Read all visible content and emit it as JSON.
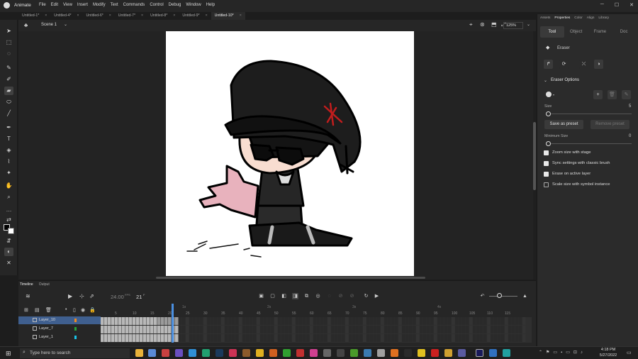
{
  "app": {
    "name": "Animate",
    "menus": [
      "File",
      "Edit",
      "View",
      "Insert",
      "Modify",
      "Text",
      "Commands",
      "Control",
      "Debug",
      "Window",
      "Help"
    ]
  },
  "doc_tabs": [
    {
      "label": "Untitled-1*",
      "active": false
    },
    {
      "label": "Untitled-4*",
      "active": false
    },
    {
      "label": "Untitled-6*",
      "active": false
    },
    {
      "label": "Untitled-7*",
      "active": false
    },
    {
      "label": "Untitled-8*",
      "active": false
    },
    {
      "label": "Untitled-9*",
      "active": false
    },
    {
      "label": "Untitled-10*",
      "active": true
    }
  ],
  "scene": {
    "label": "Scene 1",
    "zoom": "125%"
  },
  "properties_panel": {
    "tabs": [
      "Assets",
      "Properties",
      "Color",
      "Align",
      "Library"
    ],
    "active_tab": "Properties",
    "subtabs": [
      "Tool",
      "Object",
      "Frame",
      "Doc"
    ],
    "active_subtab": "Tool",
    "tool_name": "Eraser",
    "section": "Eraser Options",
    "size_label": "Size",
    "size_value": "5",
    "size_fraction": 0.0,
    "save_preset": "Save as preset",
    "remove_preset": "Remove preset",
    "min_size_label": "Minimum Size",
    "min_size_value": "0",
    "options": [
      {
        "label": "Zoom size with stage",
        "checked": true
      },
      {
        "label": "Sync settings with classic brush",
        "checked": true
      },
      {
        "label": "Erase on active layer",
        "checked": true
      },
      {
        "label": "Scale size with symbol instance",
        "checked": false
      }
    ]
  },
  "timeline": {
    "tabs": [
      "Timeline",
      "Output"
    ],
    "fps": "24.00",
    "fps_unit": "FPS",
    "current_frame": "21",
    "layers": [
      {
        "name": "Layer_10",
        "color": "#f08a1f",
        "selected": true
      },
      {
        "name": "Layer_7",
        "color": "#26a336",
        "selected": false
      },
      {
        "name": "Layer_1",
        "color": "#19c3e8",
        "selected": false
      }
    ],
    "ruler": [
      "5",
      "10",
      "15",
      "20",
      "25",
      "30",
      "35",
      "40",
      "45",
      "50",
      "55",
      "60",
      "65",
      "70",
      "75",
      "80",
      "85",
      "90",
      "95",
      "100",
      "105",
      "110",
      "115"
    ],
    "seconds": [
      "1s",
      "2s",
      "3s",
      "4s"
    ]
  },
  "taskbar": {
    "search_placeholder": "Type here to search",
    "time": "4:18 PM",
    "date": "5/27/2022"
  },
  "colors": {
    "accent": "#4a8fe0",
    "layer_selected": "#3f5f8f"
  }
}
